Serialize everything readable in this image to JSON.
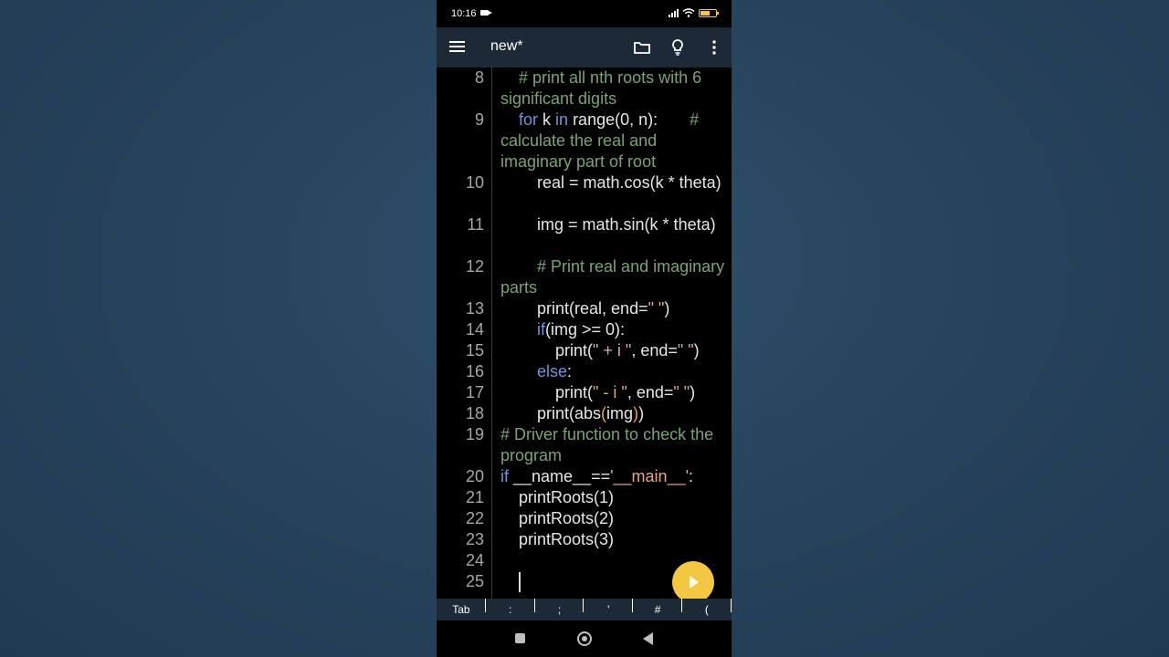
{
  "status": {
    "time": "10:16",
    "battery_icon": "battery-icon",
    "wifi_icon": "wifi-icon",
    "signal_icon": "signal-icon"
  },
  "appbar": {
    "title": "new*",
    "menu_icon": "menu-icon",
    "folder_icon": "folder-icon",
    "bulb_icon": "lightbulb-icon",
    "more_icon": "more-vert-icon"
  },
  "editor": {
    "lines": [
      {
        "n": "8",
        "segments": [
          {
            "t": "    ",
            "c": ""
          },
          {
            "t": "# print all nth roots with 6 significant digits",
            "c": "cm"
          }
        ]
      },
      {
        "n": "9",
        "segments": [
          {
            "t": "    ",
            "c": ""
          },
          {
            "t": "for",
            "c": "kw"
          },
          {
            "t": " k ",
            "c": ""
          },
          {
            "t": "in",
            "c": "kw"
          },
          {
            "t": " range(0, n):       ",
            "c": ""
          },
          {
            "t": "# calculate the real and imaginary part of root",
            "c": "cm"
          }
        ]
      },
      {
        "n": "10",
        "segments": [
          {
            "t": "        real = math.cos(k * theta)",
            "c": ""
          }
        ]
      },
      {
        "n": "11",
        "segments": [
          {
            "t": "        img = math.sin(k * theta)",
            "c": ""
          }
        ]
      },
      {
        "n": "12",
        "segments": [
          {
            "t": "        ",
            "c": ""
          },
          {
            "t": "# Print real and imaginary parts",
            "c": "cm"
          }
        ]
      },
      {
        "n": "13",
        "segments": [
          {
            "t": "        print(real, end=",
            "c": ""
          },
          {
            "t": "\" \"",
            "c": "str"
          },
          {
            "t": ")",
            "c": ""
          }
        ]
      },
      {
        "n": "14",
        "segments": [
          {
            "t": "        ",
            "c": ""
          },
          {
            "t": "if",
            "c": "kw"
          },
          {
            "t": "(img >= 0):",
            "c": ""
          }
        ]
      },
      {
        "n": "15",
        "segments": [
          {
            "t": "            print(",
            "c": ""
          },
          {
            "t": "\" + i \"",
            "c": "str"
          },
          {
            "t": ", end=",
            "c": ""
          },
          {
            "t": "\" \"",
            "c": "str"
          },
          {
            "t": ")",
            "c": ""
          }
        ]
      },
      {
        "n": "16",
        "segments": [
          {
            "t": "        ",
            "c": ""
          },
          {
            "t": "else",
            "c": "kw"
          },
          {
            "t": ":",
            "c": ""
          }
        ]
      },
      {
        "n": "17",
        "segments": [
          {
            "t": "            print(",
            "c": ""
          },
          {
            "t": "\" - i \"",
            "c": "str"
          },
          {
            "t": ", end=",
            "c": ""
          },
          {
            "t": "\" \"",
            "c": "str"
          },
          {
            "t": ")",
            "c": ""
          }
        ]
      },
      {
        "n": "18",
        "segments": [
          {
            "t": "        print(abs",
            "c": ""
          },
          {
            "t": "(",
            "c": "par"
          },
          {
            "t": "img",
            "c": ""
          },
          {
            "t": ")",
            "c": "par"
          },
          {
            "t": ")",
            "c": ""
          }
        ]
      },
      {
        "n": "19",
        "segments": [
          {
            "t": "# Driver function to check the program",
            "c": "cm"
          }
        ]
      },
      {
        "n": "20",
        "segments": [
          {
            "t": "if",
            "c": "kw"
          },
          {
            "t": " __name__==",
            "c": ""
          },
          {
            "t": "'__main__'",
            "c": "str"
          },
          {
            "t": ":",
            "c": ""
          }
        ]
      },
      {
        "n": "21",
        "segments": [
          {
            "t": "    printRoots(1)",
            "c": ""
          }
        ]
      },
      {
        "n": "22",
        "segments": [
          {
            "t": "    printRoots(2)",
            "c": ""
          }
        ]
      },
      {
        "n": "23",
        "segments": [
          {
            "t": "    printRoots(3)",
            "c": ""
          }
        ]
      },
      {
        "n": "24",
        "segments": [
          {
            "t": "",
            "c": ""
          }
        ]
      },
      {
        "n": "25",
        "segments": [
          {
            "t": "    ",
            "c": ""
          }
        ],
        "cursor": true
      }
    ]
  },
  "run_button": {
    "icon": "play-icon"
  },
  "keys": [
    "Tab",
    ":",
    ";",
    "'",
    "#",
    "("
  ],
  "nav": {
    "recent_icon": "recent-apps-icon",
    "home_icon": "home-icon",
    "back_icon": "back-icon"
  }
}
